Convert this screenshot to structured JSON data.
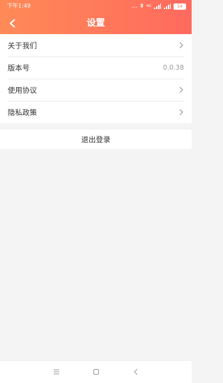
{
  "status_bar": {
    "time": "下午1:49",
    "more_indicator": "...",
    "network_label": "4G",
    "battery_level": "54"
  },
  "header": {
    "title": "设置",
    "back_icon": "chevron-left-icon"
  },
  "settings": {
    "items": [
      {
        "label": "关于我们",
        "value": "",
        "chevron": true
      },
      {
        "label": "版本号",
        "value": "0.0.38",
        "chevron": false
      },
      {
        "label": "使用协议",
        "value": "",
        "chevron": true
      },
      {
        "label": "隐私政策",
        "value": "",
        "chevron": true
      }
    ]
  },
  "logout": {
    "label": "退出登录"
  },
  "colors": {
    "header_start": "#ff8a57",
    "header_end": "#ff6a5e",
    "background": "#f4f4f4",
    "text": "#333333",
    "muted": "#999999"
  },
  "system_nav": {
    "menu_icon": "menu-icon",
    "home_icon": "home-square-icon",
    "back_icon": "back-triangle-icon"
  }
}
